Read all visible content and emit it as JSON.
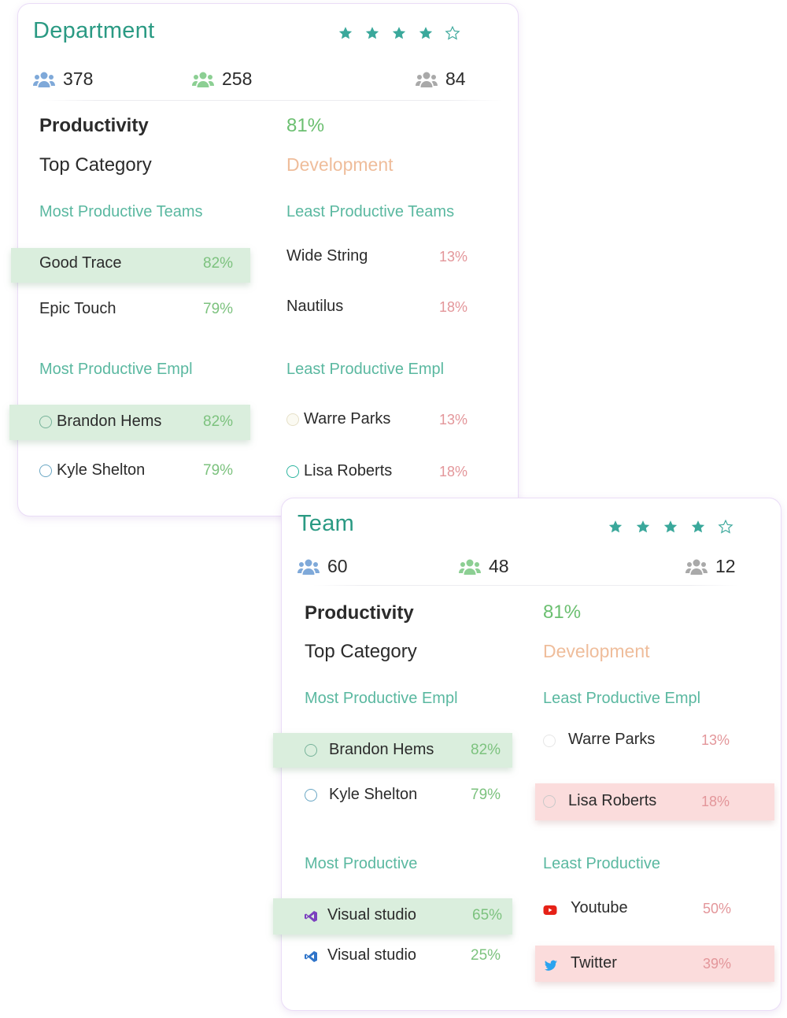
{
  "department": {
    "title": "Department",
    "rating": {
      "filled": 4,
      "total": 5
    },
    "stats": [
      {
        "icon": "people-icon",
        "color": "#7fa9d9",
        "value": "378"
      },
      {
        "icon": "people-icon",
        "color": "#8ccf93",
        "value": "258"
      },
      {
        "icon": "people-icon",
        "color": "#a9a9a9",
        "value": "84"
      }
    ],
    "productivity_label": "Productivity",
    "productivity_value": "81%",
    "top_category_label": "Top Category",
    "top_category_value": "Development",
    "most_productive_teams": {
      "heading": "Most Productive Teams",
      "items": [
        {
          "name": "Good Trace",
          "value": "82%",
          "highlighted": true
        },
        {
          "name": "Epic Touch",
          "value": "79%",
          "highlighted": false
        }
      ]
    },
    "least_productive_teams": {
      "heading": "Least Productive Teams",
      "items": [
        {
          "name": "Wide String",
          "value": "13%"
        },
        {
          "name": "Nautilus",
          "value": "18%"
        }
      ]
    },
    "most_productive_empl": {
      "heading": "Most Productive Empl",
      "items": [
        {
          "name": "Brandon Hems",
          "value": "82%",
          "highlighted": true
        },
        {
          "name": "Kyle Shelton",
          "value": "79%",
          "highlighted": false
        }
      ]
    },
    "least_productive_empl": {
      "heading": "Least Productive Empl",
      "items": [
        {
          "name": "Warre Parks",
          "value": "13%"
        },
        {
          "name": "Lisa Roberts",
          "value": "18%"
        }
      ]
    }
  },
  "team": {
    "title": "Team",
    "rating": {
      "filled": 4,
      "total": 5
    },
    "stats": [
      {
        "icon": "people-icon",
        "color": "#7fa9d9",
        "value": "60"
      },
      {
        "icon": "people-icon",
        "color": "#8ccf93",
        "value": "48"
      },
      {
        "icon": "people-icon",
        "color": "#a9a9a9",
        "value": "12"
      }
    ],
    "productivity_label": "Productivity",
    "productivity_value": "81%",
    "top_category_label": "Top Category",
    "top_category_value": "Development",
    "most_productive_empl": {
      "heading": "Most Productive Empl",
      "items": [
        {
          "name": "Brandon Hems",
          "value": "82%",
          "highlighted": true
        },
        {
          "name": "Kyle Shelton",
          "value": "79%",
          "highlighted": false
        }
      ]
    },
    "least_productive_empl": {
      "heading": "Least Productive Empl",
      "items": [
        {
          "name": "Warre Parks",
          "value": "13%",
          "highlighted": false
        },
        {
          "name": "Lisa Roberts",
          "value": "18%",
          "highlighted": true
        }
      ]
    },
    "most_productive_apps": {
      "heading": "Most Productive",
      "items": [
        {
          "icon": "visual-studio-icon",
          "icon_color": "#7b3fbf",
          "name": "Visual studio",
          "value": "65%",
          "highlighted": true
        },
        {
          "icon": "vscode-icon",
          "icon_color": "#2f74c9",
          "name": "Visual studio",
          "value": "25%",
          "highlighted": false
        }
      ]
    },
    "least_productive_apps": {
      "heading": "Least Productive",
      "items": [
        {
          "icon": "youtube-icon",
          "icon_color": "#e62117",
          "name": "Youtube",
          "value": "50%",
          "highlighted": false
        },
        {
          "icon": "twitter-icon",
          "icon_color": "#2aa3ef",
          "name": "Twitter",
          "value": "39%",
          "highlighted": true
        }
      ]
    }
  },
  "colors": {
    "title_teal": "#2a9a83",
    "star_teal": "#3aa89b",
    "section_heading": "#5ab8a0",
    "productivity_green": "#6bbf70",
    "category_peach": "#efbd9b",
    "percent_green": "#7cc27e",
    "percent_red": "#e3969a",
    "highlight_green": "#daeedd",
    "highlight_red": "#fbdcdc",
    "card_border": "#eadcf7"
  }
}
